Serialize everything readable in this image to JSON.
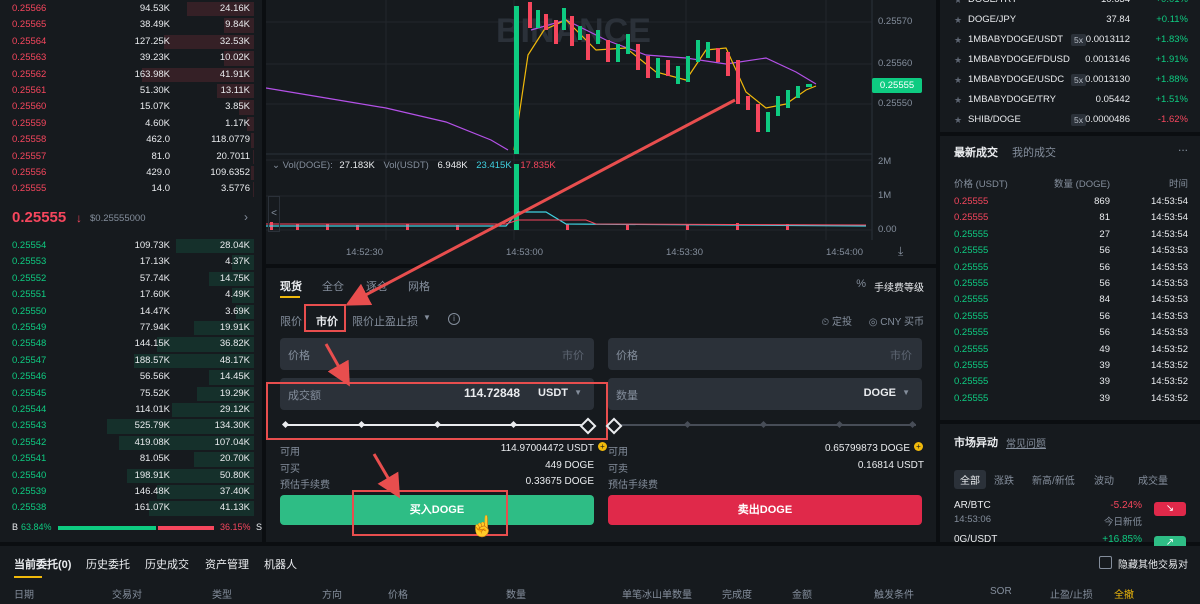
{
  "orderbook": {
    "asks": [
      {
        "price": "0.25566",
        "qty": "94.53K",
        "total": "24.16K",
        "depth": 0.45
      },
      {
        "price": "0.25565",
        "qty": "38.49K",
        "total": "9.84K",
        "depth": 0.2
      },
      {
        "price": "0.25564",
        "qty": "127.25K",
        "total": "32.53K",
        "depth": 0.6
      },
      {
        "price": "0.25563",
        "qty": "39.23K",
        "total": "10.02K",
        "depth": 0.2
      },
      {
        "price": "0.25562",
        "qty": "163.98K",
        "total": "41.91K",
        "depth": 0.75
      },
      {
        "price": "0.25561",
        "qty": "51.30K",
        "total": "13.11K",
        "depth": 0.25
      },
      {
        "price": "0.25560",
        "qty": "15.07K",
        "total": "3.85K",
        "depth": 0.1
      },
      {
        "price": "0.25559",
        "qty": "4.60K",
        "total": "1.17K",
        "depth": 0.05
      },
      {
        "price": "0.25558",
        "qty": "462.0",
        "total": "118.0779",
        "depth": 0.02
      },
      {
        "price": "0.25557",
        "qty": "81.0",
        "total": "20.7011",
        "depth": 0.01
      },
      {
        "price": "0.25556",
        "qty": "429.0",
        "total": "109.6352",
        "depth": 0.02
      },
      {
        "price": "0.25555",
        "qty": "14.0",
        "total": "3.5776",
        "depth": 0.01
      }
    ],
    "last_price": "0.25555",
    "last_arrow": "↓",
    "last_usd": "$0.25555000",
    "bids": [
      {
        "price": "0.25554",
        "qty": "109.73K",
        "total": "28.04K",
        "depth": 0.52
      },
      {
        "price": "0.25553",
        "qty": "17.13K",
        "total": "4.37K",
        "depth": 0.15
      },
      {
        "price": "0.25552",
        "qty": "57.74K",
        "total": "14.75K",
        "depth": 0.3
      },
      {
        "price": "0.25551",
        "qty": "17.60K",
        "total": "4.49K",
        "depth": 0.15
      },
      {
        "price": "0.25550",
        "qty": "14.47K",
        "total": "3.69K",
        "depth": 0.12
      },
      {
        "price": "0.25549",
        "qty": "77.94K",
        "total": "19.91K",
        "depth": 0.4
      },
      {
        "price": "0.25548",
        "qty": "144.15K",
        "total": "36.82K",
        "depth": 0.65
      },
      {
        "price": "0.25547",
        "qty": "188.57K",
        "total": "48.17K",
        "depth": 0.8
      },
      {
        "price": "0.25546",
        "qty": "56.56K",
        "total": "14.45K",
        "depth": 0.3
      },
      {
        "price": "0.25545",
        "qty": "75.52K",
        "total": "19.29K",
        "depth": 0.38
      },
      {
        "price": "0.25544",
        "qty": "114.01K",
        "total": "29.12K",
        "depth": 0.55
      },
      {
        "price": "0.25543",
        "qty": "525.79K",
        "total": "134.30K",
        "depth": 0.98
      },
      {
        "price": "0.25542",
        "qty": "419.08K",
        "total": "107.04K",
        "depth": 0.9
      },
      {
        "price": "0.25541",
        "qty": "81.05K",
        "total": "20.70K",
        "depth": 0.4
      },
      {
        "price": "0.25540",
        "qty": "198.91K",
        "total": "50.80K",
        "depth": 0.85
      },
      {
        "price": "0.25539",
        "qty": "146.48K",
        "total": "37.40K",
        "depth": 0.65
      },
      {
        "price": "0.25538",
        "qty": "161.07K",
        "total": "41.13K",
        "depth": 0.7
      }
    ],
    "ratio_b_label": "B",
    "ratio_b": "63.84%",
    "ratio_s": "36.15%",
    "ratio_s_label": "S",
    "ratio_b_fraction": 0.6384
  },
  "chart": {
    "price_ticks": [
      "0.25570",
      "0.25560",
      "0.25550"
    ],
    "current_price": "0.25555",
    "volume_ticks": [
      "2M",
      "1M",
      "0.00"
    ],
    "time_ticks": [
      "14:52:30",
      "14:53:00",
      "14:53:30",
      "14:54:00"
    ],
    "vol_legend": {
      "doge_label": "Vol(DOGE):",
      "doge_value": "27.183K",
      "usdt_label": "Vol(USDT)",
      "usdt_value": "6.948K",
      "ma1": "23.415K",
      "ma2": "17.835K"
    },
    "collapse_arrow": "<",
    "watermark": "BINANCE"
  },
  "form": {
    "tabs": [
      "现货",
      "全仓",
      "逐仓",
      "网格"
    ],
    "fee_label": "手续费等级",
    "fee_icon_text": "%",
    "order_types": [
      "限价",
      "市价",
      "限价止盈止损"
    ],
    "info_icon": "i",
    "dingtou": "定投",
    "cny_label": "CNY 买币",
    "buy": {
      "price_label": "价格",
      "price_value": "市价",
      "amount_label": "成交额",
      "amount_value": "114.72848",
      "amount_unit": "USDT",
      "available_label": "可用",
      "available_value": "114.97004472 USDT",
      "can_buy_label": "可买",
      "can_buy_value": "449 DOGE",
      "fee_label": "预估手续费",
      "fee_value": "0.33675 DOGE",
      "button": "买入DOGE",
      "slider_fraction": 1.0
    },
    "sell": {
      "price_label": "价格",
      "price_value": "市价",
      "qty_label": "数量",
      "qty_unit": "DOGE",
      "available_label": "可用",
      "available_value": "0.65799873 DOGE",
      "can_sell_label": "可卖",
      "can_sell_value": "0.16814 USDT",
      "fee_label": "预估手续费",
      "button": "卖出DOGE",
      "slider_fraction": 0.0
    }
  },
  "pairs": [
    {
      "name": "DOGE/TRY",
      "lev": "",
      "price": "10.634",
      "change": "+0.01%",
      "up": true
    },
    {
      "name": "DOGE/JPY",
      "lev": "",
      "price": "37.84",
      "change": "+0.11%",
      "up": true
    },
    {
      "name": "1MBABYDOGE/USDT",
      "lev": "5x",
      "price": "0.0013112",
      "change": "+1.83%",
      "up": true
    },
    {
      "name": "1MBABYDOGE/FDUSD",
      "lev": "",
      "price": "0.0013146",
      "change": "+1.91%",
      "up": true
    },
    {
      "name": "1MBABYDOGE/USDC",
      "lev": "5x",
      "price": "0.0013130",
      "change": "+1.88%",
      "up": true
    },
    {
      "name": "1MBABYDOGE/TRY",
      "lev": "",
      "price": "0.05442",
      "change": "+1.51%",
      "up": true
    },
    {
      "name": "SHIB/DOGE",
      "lev": "5x",
      "price": "0.0000486",
      "change": "-1.62%",
      "up": false
    }
  ],
  "trades": {
    "tab_latest": "最新成交",
    "tab_mine": "我的成交",
    "more": "...",
    "h_price": "价格 (USDT)",
    "h_qty": "数量 (DOGE)",
    "h_time": "时间",
    "rows": [
      {
        "price": "0.25555",
        "qty": "869",
        "time": "14:53:54",
        "up": false
      },
      {
        "price": "0.25555",
        "qty": "81",
        "time": "14:53:54",
        "up": false
      },
      {
        "price": "0.25555",
        "qty": "27",
        "time": "14:53:54",
        "up": true
      },
      {
        "price": "0.25555",
        "qty": "56",
        "time": "14:53:53",
        "up": true
      },
      {
        "price": "0.25555",
        "qty": "56",
        "time": "14:53:53",
        "up": true
      },
      {
        "price": "0.25555",
        "qty": "56",
        "time": "14:53:53",
        "up": true
      },
      {
        "price": "0.25555",
        "qty": "84",
        "time": "14:53:53",
        "up": true
      },
      {
        "price": "0.25555",
        "qty": "56",
        "time": "14:53:53",
        "up": true
      },
      {
        "price": "0.25555",
        "qty": "56",
        "time": "14:53:53",
        "up": true
      },
      {
        "price": "0.25555",
        "qty": "49",
        "time": "14:53:52",
        "up": true
      },
      {
        "price": "0.25555",
        "qty": "39",
        "time": "14:53:52",
        "up": true
      },
      {
        "price": "0.25555",
        "qty": "39",
        "time": "14:53:52",
        "up": true
      },
      {
        "price": "0.25555",
        "qty": "39",
        "time": "14:53:52",
        "up": true
      }
    ]
  },
  "movers": {
    "title": "市场异动",
    "faq": "常见问题",
    "tabs": [
      "全部",
      "涨跌",
      "新高/新低",
      "波动",
      "成交量"
    ],
    "rows": [
      {
        "pair": "AR/BTC",
        "time": "14:53:06",
        "change": "-5.24%",
        "desc": "今日新低",
        "up": false
      },
      {
        "pair": "0G/USDT",
        "time": "",
        "change": "+16.85%",
        "desc": "",
        "up": true
      }
    ]
  },
  "bottom": {
    "tabs": [
      "当前委托(0)",
      "历史委托",
      "历史成交",
      "资产管理",
      "机器人"
    ],
    "hide_label": "隐藏其他交易对",
    "columns": [
      "日期",
      "交易对",
      "类型",
      "方向",
      "价格",
      "数量",
      "单笔冰山单数量",
      "完成度",
      "金额",
      "触发条件",
      "SOR",
      "止盈/止损",
      "全撤"
    ]
  }
}
